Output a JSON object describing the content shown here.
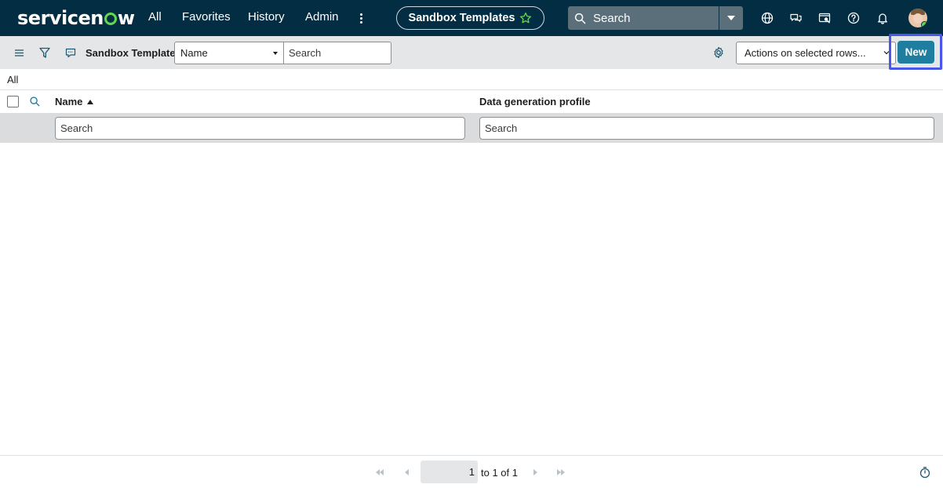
{
  "brand": {
    "logo_pre": "servicen",
    "logo_post": "w"
  },
  "topnav": {
    "links": [
      "All",
      "Favorites",
      "History",
      "Admin"
    ],
    "context_title": "Sandbox Templates",
    "search_placeholder": "Search",
    "icons": [
      "globe-icon",
      "chat-icon",
      "accessibility-icon",
      "help-icon",
      "bell-icon"
    ]
  },
  "listbar": {
    "title": "Sandbox Templates",
    "field_select": "Name",
    "search_placeholder": "Search",
    "actions_label": "Actions on selected rows...",
    "new_label": "New"
  },
  "breadcrumb": {
    "label": "All"
  },
  "table": {
    "columns": [
      "Name",
      "Data generation profile"
    ],
    "sort_column": "Name",
    "sort_direction": "ascending",
    "column_search_placeholder": "Search",
    "rows": []
  },
  "pagination": {
    "current": "1",
    "text": "to 1 of 1"
  },
  "colors": {
    "nav_bg": "#032d42",
    "accent": "#1f7e9f",
    "highlight": "#4758e8",
    "logo_green": "#62d84e"
  }
}
